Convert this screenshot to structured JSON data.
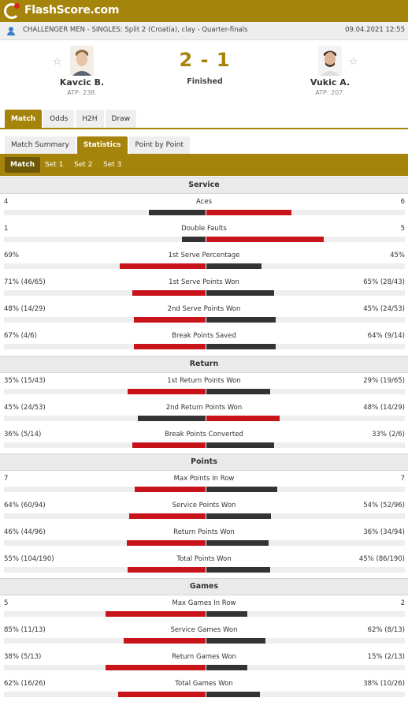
{
  "brand": {
    "logo_text": "FlashScore.com"
  },
  "info": {
    "tournament": "CHALLENGER MEN - SINGLES: Split 2 (Croatia), clay - Quarter-finals",
    "datetime": "09.04.2021 12:55"
  },
  "match": {
    "home": {
      "name": "Kavcic B.",
      "rank": "ATP: 238."
    },
    "away": {
      "name": "Vukic A.",
      "rank": "ATP: 207."
    },
    "score": "2 - 1",
    "status": "Finished"
  },
  "tabs": [
    "Match",
    "Odds",
    "H2H",
    "Draw"
  ],
  "subtabs": [
    "Match Summary",
    "Statistics",
    "Point by Point"
  ],
  "sets": [
    "Match",
    "Set 1",
    "Set 2",
    "Set 3"
  ],
  "colors": {
    "accent": "#a5840c",
    "winner_bar": "#c8131a",
    "loser_bar": "#333333"
  },
  "sections": [
    {
      "title": "Service",
      "stats": [
        {
          "name": "Aces",
          "home": "4",
          "away": "6",
          "home_share": 0.4,
          "away_share": 0.6
        },
        {
          "name": "Double Faults",
          "home": "1",
          "away": "5",
          "home_share": 0.17,
          "away_share": 0.83
        },
        {
          "name": "1st Serve Percentage",
          "home": "69%",
          "away": "45%",
          "home_share": 0.61,
          "away_share": 0.39
        },
        {
          "name": "1st Serve Points Won",
          "home": "71% (46/65)",
          "away": "65% (28/43)",
          "home_share": 0.52,
          "away_share": 0.48
        },
        {
          "name": "2nd Serve Points Won",
          "home": "48% (14/29)",
          "away": "45% (24/53)",
          "home_share": 0.51,
          "away_share": 0.49
        },
        {
          "name": "Break Points Saved",
          "home": "67% (4/6)",
          "away": "64% (9/14)",
          "home_share": 0.51,
          "away_share": 0.49
        }
      ]
    },
    {
      "title": "Return",
      "stats": [
        {
          "name": "1st Return Points Won",
          "home": "35% (15/43)",
          "away": "29% (19/65)",
          "home_share": 0.55,
          "away_share": 0.45
        },
        {
          "name": "2nd Return Points Won",
          "home": "45% (24/53)",
          "away": "48% (14/29)",
          "home_share": 0.48,
          "away_share": 0.52
        },
        {
          "name": "Break Points Converted",
          "home": "36% (5/14)",
          "away": "33% (2/6)",
          "home_share": 0.52,
          "away_share": 0.48
        }
      ]
    },
    {
      "title": "Points",
      "stats": [
        {
          "name": "Max Points In Row",
          "home": "7",
          "away": "7",
          "home_share": 0.5,
          "away_share": 0.5
        },
        {
          "name": "Service Points Won",
          "home": "64% (60/94)",
          "away": "54% (52/96)",
          "home_share": 0.54,
          "away_share": 0.46
        },
        {
          "name": "Return Points Won",
          "home": "46% (44/96)",
          "away": "36% (34/94)",
          "home_share": 0.56,
          "away_share": 0.44
        },
        {
          "name": "Total Points Won",
          "home": "55% (104/190)",
          "away": "45% (86/190)",
          "home_share": 0.55,
          "away_share": 0.45
        }
      ]
    },
    {
      "title": "Games",
      "stats": [
        {
          "name": "Max Games In Row",
          "home": "5",
          "away": "2",
          "home_share": 0.71,
          "away_share": 0.29
        },
        {
          "name": "Service Games Won",
          "home": "85% (11/13)",
          "away": "62% (8/13)",
          "home_share": 0.58,
          "away_share": 0.42
        },
        {
          "name": "Return Games Won",
          "home": "38% (5/13)",
          "away": "15% (2/13)",
          "home_share": 0.71,
          "away_share": 0.29
        },
        {
          "name": "Total Games Won",
          "home": "62% (16/26)",
          "away": "38% (10/26)",
          "home_share": 0.62,
          "away_share": 0.38
        }
      ]
    }
  ]
}
